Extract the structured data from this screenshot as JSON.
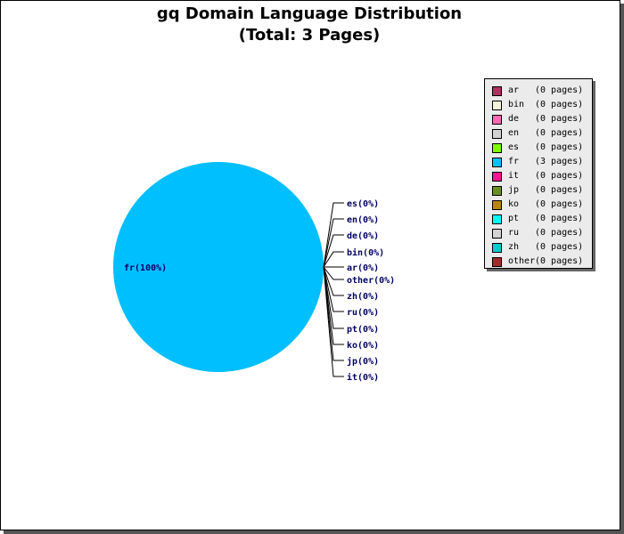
{
  "chart_data": {
    "type": "pie",
    "title": "gq Domain Language Distribution",
    "subtitle": "(Total: 3 Pages)",
    "slices": [
      {
        "label": "ar",
        "pages": 0,
        "percent": 0,
        "color": "#b03060",
        "count_text": "(0 pages)",
        "slice_label": "ar(0%)"
      },
      {
        "label": "bin",
        "pages": 0,
        "percent": 0,
        "color": "#f5f5dc",
        "count_text": "(0 pages)",
        "slice_label": "bin(0%)"
      },
      {
        "label": "de",
        "pages": 0,
        "percent": 0,
        "color": "#ff69b4",
        "count_text": "(0 pages)",
        "slice_label": "de(0%)"
      },
      {
        "label": "en",
        "pages": 0,
        "percent": 0,
        "color": "#d3d3d3",
        "count_text": "(0 pages)",
        "slice_label": "en(0%)"
      },
      {
        "label": "es",
        "pages": 0,
        "percent": 0,
        "color": "#7cfc00",
        "count_text": "(0 pages)",
        "slice_label": "es(0%)"
      },
      {
        "label": "fr",
        "pages": 3,
        "percent": 100,
        "color": "#00bfff",
        "count_text": "(3 pages)",
        "slice_label": "fr(100%)"
      },
      {
        "label": "it",
        "pages": 0,
        "percent": 0,
        "color": "#ff1493",
        "count_text": "(0 pages)",
        "slice_label": "it(0%)"
      },
      {
        "label": "jp",
        "pages": 0,
        "percent": 0,
        "color": "#6b8e23",
        "count_text": "(0 pages)",
        "slice_label": "jp(0%)"
      },
      {
        "label": "ko",
        "pages": 0,
        "percent": 0,
        "color": "#b8860b",
        "count_text": "(0 pages)",
        "slice_label": "ko(0%)"
      },
      {
        "label": "pt",
        "pages": 0,
        "percent": 0,
        "color": "#00ffff",
        "count_text": "(0 pages)",
        "slice_label": "pt(0%)"
      },
      {
        "label": "ru",
        "pages": 0,
        "percent": 0,
        "color": "#d3d3d3",
        "count_text": "(0 pages)",
        "slice_label": "ru(0%)"
      },
      {
        "label": "zh",
        "pages": 0,
        "percent": 0,
        "color": "#00ced1",
        "count_text": "(0 pages)",
        "slice_label": "zh(0%)"
      },
      {
        "label": "other",
        "pages": 0,
        "percent": 0,
        "color": "#a52a2a",
        "count_text": "(0 pages)",
        "slice_label": "other(0%)"
      }
    ],
    "callout_order": [
      "es",
      "en",
      "de",
      "bin",
      "ar",
      "other",
      "zh",
      "ru",
      "pt",
      "ko",
      "jp",
      "it"
    ],
    "legend_placement": "top-right",
    "label_color": "#000066"
  }
}
